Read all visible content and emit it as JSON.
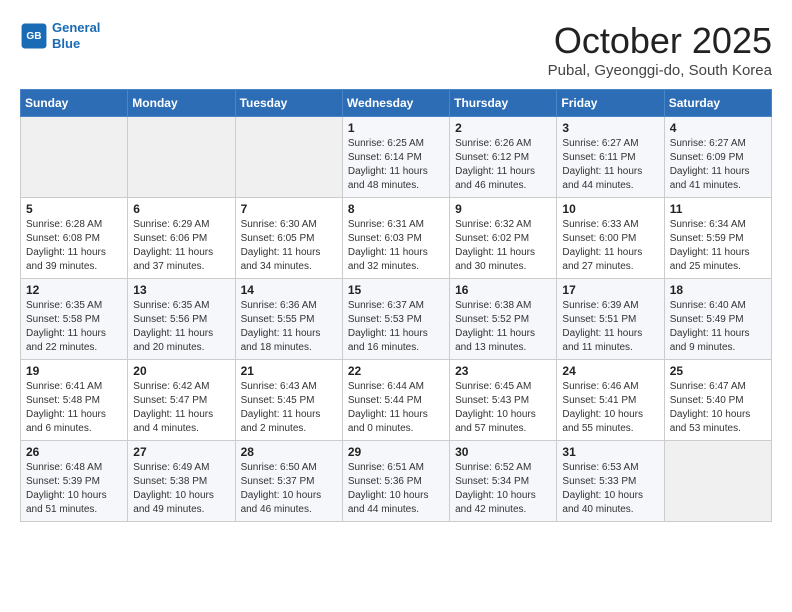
{
  "header": {
    "logo_line1": "General",
    "logo_line2": "Blue",
    "month": "October 2025",
    "location": "Pubal, Gyeonggi-do, South Korea"
  },
  "days_of_week": [
    "Sunday",
    "Monday",
    "Tuesday",
    "Wednesday",
    "Thursday",
    "Friday",
    "Saturday"
  ],
  "weeks": [
    [
      {
        "day": "",
        "info": ""
      },
      {
        "day": "",
        "info": ""
      },
      {
        "day": "",
        "info": ""
      },
      {
        "day": "1",
        "info": "Sunrise: 6:25 AM\nSunset: 6:14 PM\nDaylight: 11 hours\nand 48 minutes."
      },
      {
        "day": "2",
        "info": "Sunrise: 6:26 AM\nSunset: 6:12 PM\nDaylight: 11 hours\nand 46 minutes."
      },
      {
        "day": "3",
        "info": "Sunrise: 6:27 AM\nSunset: 6:11 PM\nDaylight: 11 hours\nand 44 minutes."
      },
      {
        "day": "4",
        "info": "Sunrise: 6:27 AM\nSunset: 6:09 PM\nDaylight: 11 hours\nand 41 minutes."
      }
    ],
    [
      {
        "day": "5",
        "info": "Sunrise: 6:28 AM\nSunset: 6:08 PM\nDaylight: 11 hours\nand 39 minutes."
      },
      {
        "day": "6",
        "info": "Sunrise: 6:29 AM\nSunset: 6:06 PM\nDaylight: 11 hours\nand 37 minutes."
      },
      {
        "day": "7",
        "info": "Sunrise: 6:30 AM\nSunset: 6:05 PM\nDaylight: 11 hours\nand 34 minutes."
      },
      {
        "day": "8",
        "info": "Sunrise: 6:31 AM\nSunset: 6:03 PM\nDaylight: 11 hours\nand 32 minutes."
      },
      {
        "day": "9",
        "info": "Sunrise: 6:32 AM\nSunset: 6:02 PM\nDaylight: 11 hours\nand 30 minutes."
      },
      {
        "day": "10",
        "info": "Sunrise: 6:33 AM\nSunset: 6:00 PM\nDaylight: 11 hours\nand 27 minutes."
      },
      {
        "day": "11",
        "info": "Sunrise: 6:34 AM\nSunset: 5:59 PM\nDaylight: 11 hours\nand 25 minutes."
      }
    ],
    [
      {
        "day": "12",
        "info": "Sunrise: 6:35 AM\nSunset: 5:58 PM\nDaylight: 11 hours\nand 22 minutes."
      },
      {
        "day": "13",
        "info": "Sunrise: 6:35 AM\nSunset: 5:56 PM\nDaylight: 11 hours\nand 20 minutes."
      },
      {
        "day": "14",
        "info": "Sunrise: 6:36 AM\nSunset: 5:55 PM\nDaylight: 11 hours\nand 18 minutes."
      },
      {
        "day": "15",
        "info": "Sunrise: 6:37 AM\nSunset: 5:53 PM\nDaylight: 11 hours\nand 16 minutes."
      },
      {
        "day": "16",
        "info": "Sunrise: 6:38 AM\nSunset: 5:52 PM\nDaylight: 11 hours\nand 13 minutes."
      },
      {
        "day": "17",
        "info": "Sunrise: 6:39 AM\nSunset: 5:51 PM\nDaylight: 11 hours\nand 11 minutes."
      },
      {
        "day": "18",
        "info": "Sunrise: 6:40 AM\nSunset: 5:49 PM\nDaylight: 11 hours\nand 9 minutes."
      }
    ],
    [
      {
        "day": "19",
        "info": "Sunrise: 6:41 AM\nSunset: 5:48 PM\nDaylight: 11 hours\nand 6 minutes."
      },
      {
        "day": "20",
        "info": "Sunrise: 6:42 AM\nSunset: 5:47 PM\nDaylight: 11 hours\nand 4 minutes."
      },
      {
        "day": "21",
        "info": "Sunrise: 6:43 AM\nSunset: 5:45 PM\nDaylight: 11 hours\nand 2 minutes."
      },
      {
        "day": "22",
        "info": "Sunrise: 6:44 AM\nSunset: 5:44 PM\nDaylight: 11 hours\nand 0 minutes."
      },
      {
        "day": "23",
        "info": "Sunrise: 6:45 AM\nSunset: 5:43 PM\nDaylight: 10 hours\nand 57 minutes."
      },
      {
        "day": "24",
        "info": "Sunrise: 6:46 AM\nSunset: 5:41 PM\nDaylight: 10 hours\nand 55 minutes."
      },
      {
        "day": "25",
        "info": "Sunrise: 6:47 AM\nSunset: 5:40 PM\nDaylight: 10 hours\nand 53 minutes."
      }
    ],
    [
      {
        "day": "26",
        "info": "Sunrise: 6:48 AM\nSunset: 5:39 PM\nDaylight: 10 hours\nand 51 minutes."
      },
      {
        "day": "27",
        "info": "Sunrise: 6:49 AM\nSunset: 5:38 PM\nDaylight: 10 hours\nand 49 minutes."
      },
      {
        "day": "28",
        "info": "Sunrise: 6:50 AM\nSunset: 5:37 PM\nDaylight: 10 hours\nand 46 minutes."
      },
      {
        "day": "29",
        "info": "Sunrise: 6:51 AM\nSunset: 5:36 PM\nDaylight: 10 hours\nand 44 minutes."
      },
      {
        "day": "30",
        "info": "Sunrise: 6:52 AM\nSunset: 5:34 PM\nDaylight: 10 hours\nand 42 minutes."
      },
      {
        "day": "31",
        "info": "Sunrise: 6:53 AM\nSunset: 5:33 PM\nDaylight: 10 hours\nand 40 minutes."
      },
      {
        "day": "",
        "info": ""
      }
    ]
  ]
}
